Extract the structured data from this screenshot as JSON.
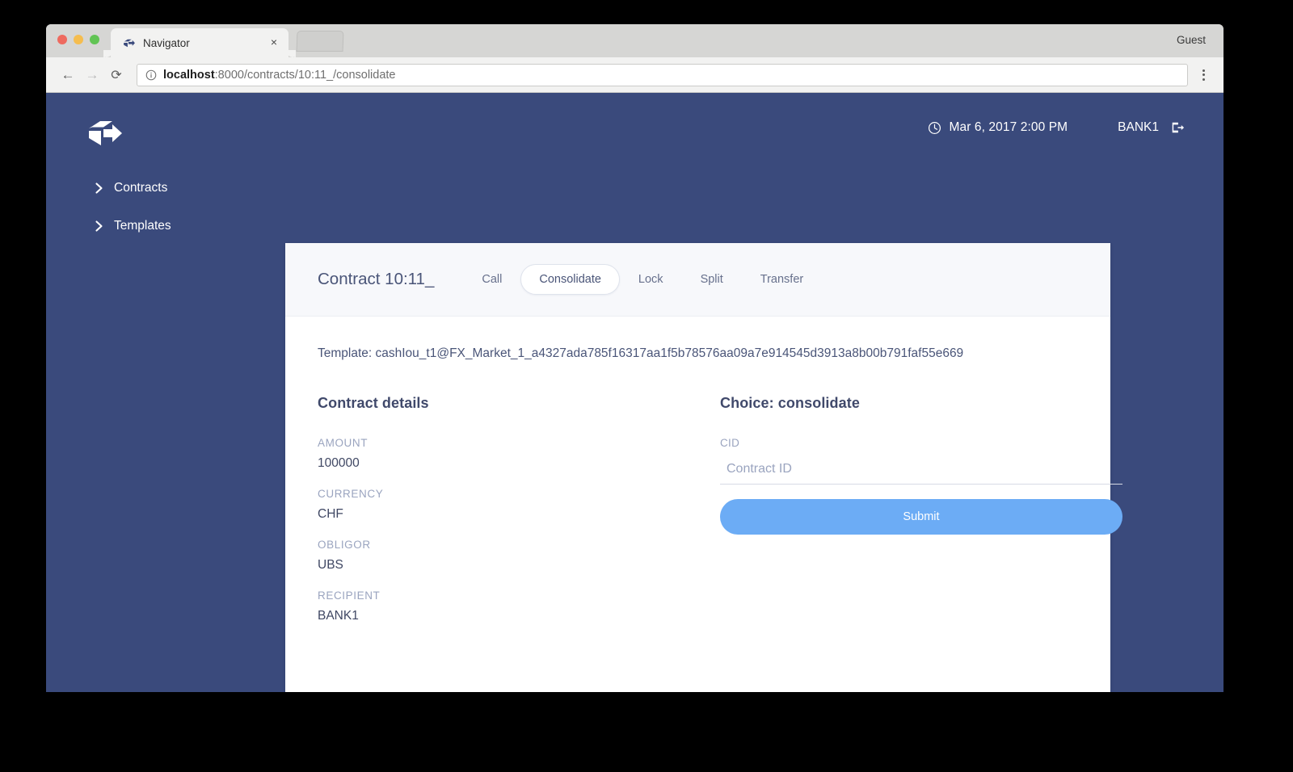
{
  "browser": {
    "tab_title": "Navigator",
    "tab_favicon": "navigator-logo-icon",
    "close_label": "×",
    "profile_label": "Guest",
    "back_label": "←",
    "forward_label": "→",
    "reload_label": "⟳",
    "url_host": "localhost",
    "url_rest": ":8000/contracts/10:11_/consolidate",
    "url_full": "localhost:8000/contracts/10:11_/consolidate",
    "info_icon": "info-circle-icon",
    "menu_icon": "kebab-menu-icon"
  },
  "app_header": {
    "logo_icon": "navigator-cube-arrow-logo",
    "clock_icon": "clock-icon",
    "datetime": "Mar 6, 2017 2:00 PM",
    "party": "BANK1",
    "logout_icon": "logout-icon"
  },
  "sidebar": {
    "items": [
      {
        "label": "Contracts",
        "icon": "chevron-right-icon"
      },
      {
        "label": "Templates",
        "icon": "chevron-right-icon"
      }
    ]
  },
  "card": {
    "title": "Contract 10:11_",
    "tabs": [
      {
        "label": "Call",
        "active": false
      },
      {
        "label": "Consolidate",
        "active": true
      },
      {
        "label": "Lock",
        "active": false
      },
      {
        "label": "Split",
        "active": false
      },
      {
        "label": "Transfer",
        "active": false
      }
    ],
    "template_line": "Template: cashIou_t1@FX_Market_1_a4327ada785f16317aa1f5b78576aa09a7e914545d3913a8b00b791faf55e669",
    "details": {
      "heading": "Contract details",
      "fields": [
        {
          "label": "AMOUNT",
          "value": "100000"
        },
        {
          "label": "CURRENCY",
          "value": "CHF"
        },
        {
          "label": "OBLIGOR",
          "value": "UBS"
        },
        {
          "label": "RECIPIENT",
          "value": "BANK1"
        }
      ]
    },
    "choice": {
      "heading": "Choice: consolidate",
      "cid_label": "CID",
      "cid_value": "",
      "cid_placeholder": "Contract ID",
      "submit_label": "Submit"
    }
  },
  "colors": {
    "app_background": "#3a4a7c",
    "card_header": "#f7f8fb",
    "card_body": "#ffffff",
    "accent_button": "#6cacf5",
    "label_muted": "#9aa4bf",
    "text_primary": "#3f4763"
  }
}
